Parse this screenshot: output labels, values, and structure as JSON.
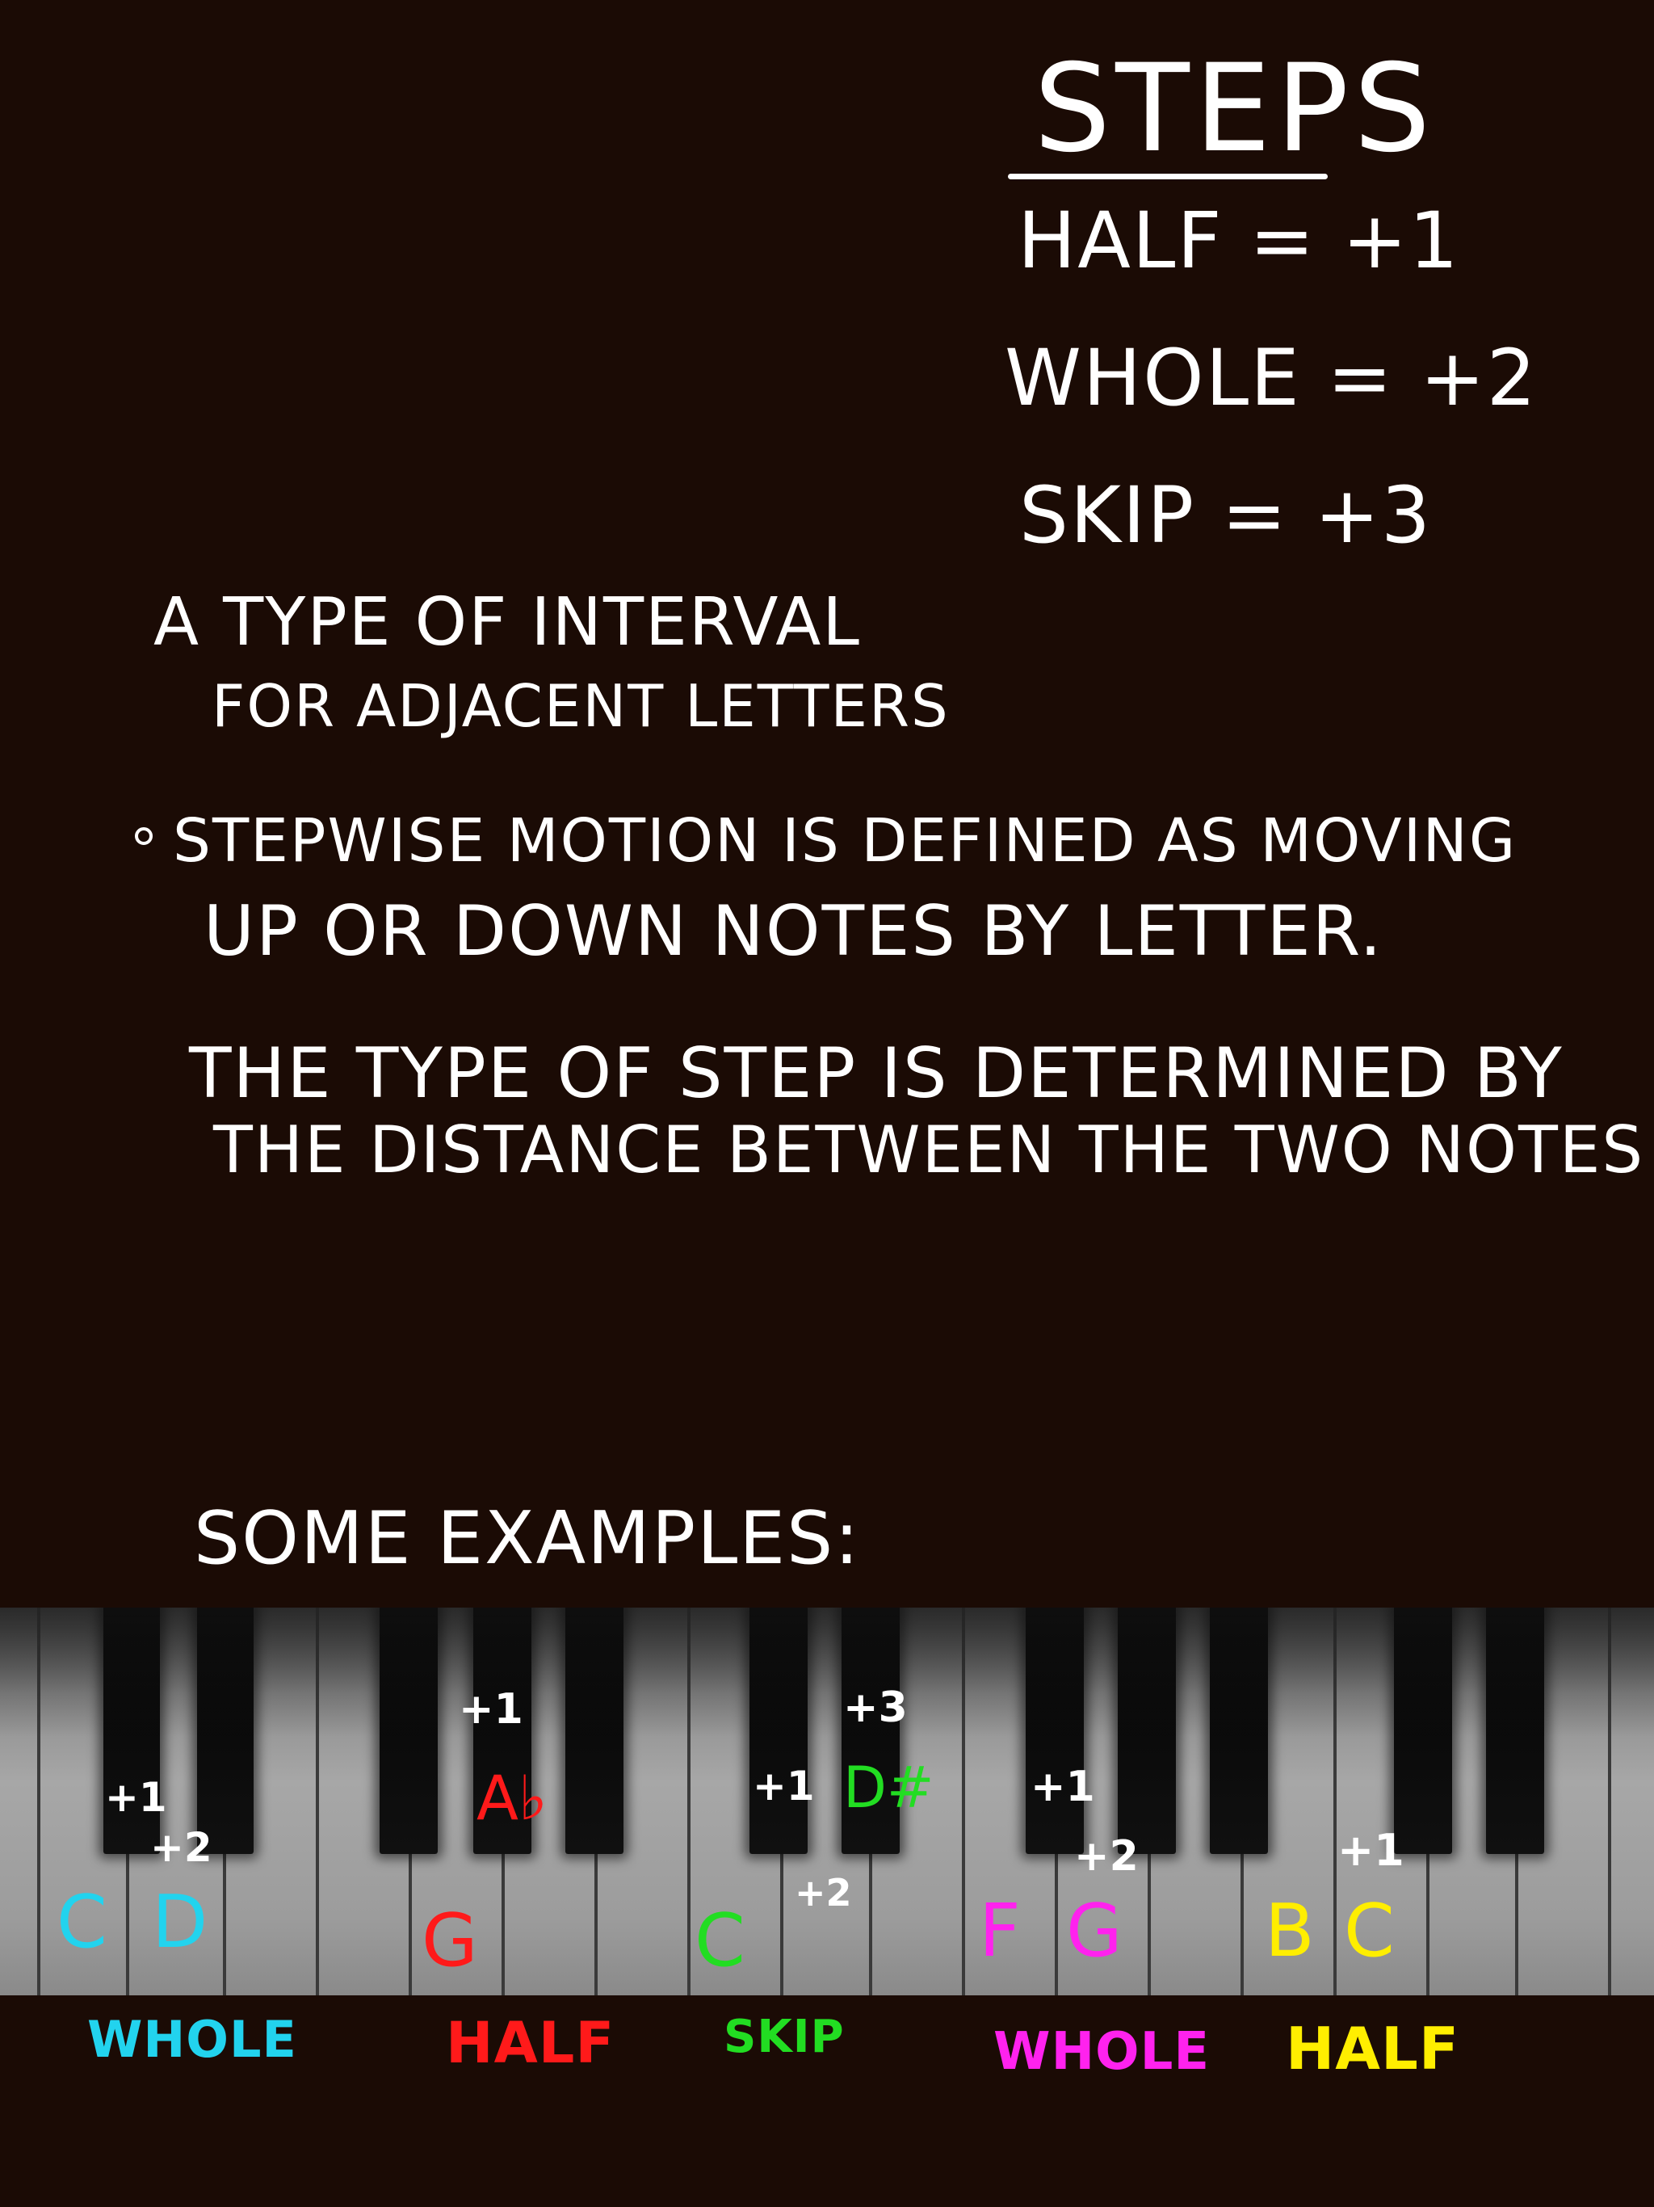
{
  "colors": {
    "background": "#1b0b05",
    "text": "#ffffff",
    "cyan": "#22d3ee",
    "red": "#ff1a1a",
    "green": "#22dd22",
    "magenta": "#ff22ee",
    "yellow": "#ffee00"
  },
  "steps_box": {
    "title": "STEPS",
    "half": "HALF = +1",
    "whole": "WHOLE = +2",
    "skip": "SKIP  = +3"
  },
  "intro": {
    "line1": "A TYPE OF INTERVAL",
    "line2": "FOR ADJACENT LETTERS"
  },
  "bullet": {
    "line1": "STEPWISE MOTION IS DEFINED AS MOVING",
    "line2": "UP OR DOWN NOTES BY LETTER."
  },
  "paragraph": {
    "line1": "THE TYPE OF STEP IS DETERMINED BY",
    "line2": "THE DISTANCE BETWEEN THE TWO NOTES"
  },
  "examples_heading": "SOME EXAMPLES:",
  "examples": {
    "ex1": {
      "note_a": "C",
      "note_b": "D",
      "int_1": "+1",
      "int_2": "+2",
      "label": "WHOLE"
    },
    "ex2": {
      "note_a": "G",
      "note_b": "A♭",
      "int_1": "+1",
      "label": "HALF"
    },
    "ex3": {
      "note_a": "C",
      "note_b": "D#",
      "int_1": "+1",
      "int_2": "+2",
      "int_3": "+3",
      "label": "SKIP"
    },
    "ex4": {
      "note_a": "F",
      "note_b": "G",
      "int_1": "+1",
      "int_2": "+2",
      "label": "WHOLE"
    },
    "ex5": {
      "note_a": "B",
      "note_b": "C",
      "int_1": "+1",
      "label": "HALF"
    }
  }
}
